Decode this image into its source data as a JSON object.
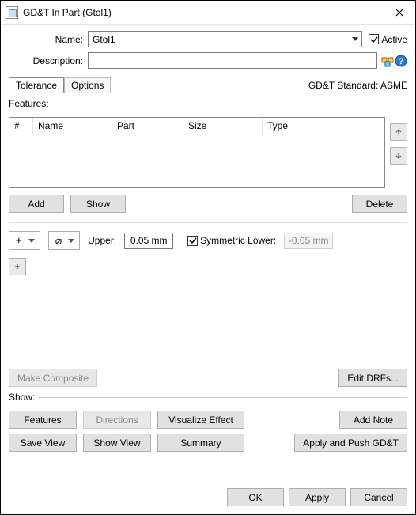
{
  "window": {
    "title": "GD&T In Part (Gtol1)"
  },
  "form": {
    "name_label": "Name:",
    "name_value": "Gtol1",
    "active_label": "Active",
    "description_label": "Description:",
    "description_value": ""
  },
  "tabs": {
    "tolerance": "Tolerance",
    "options": "Options"
  },
  "standard_label": "GD&T Standard: ASME",
  "features": {
    "legend": "Features:",
    "columns": {
      "idx": "#",
      "name": "Name",
      "part": "Part",
      "size": "Size",
      "type": "Type"
    },
    "rows": [],
    "add": "Add",
    "show": "Show",
    "delete": "Delete"
  },
  "tol": {
    "upper_label": "Upper:",
    "upper_value": "0.05 mm",
    "symmetric_label": "Symmetric Lower:",
    "lower_value": "-0.05 mm",
    "plus": "+"
  },
  "composite": {
    "make": "Make Composite",
    "edit_drfs": "Edit DRFs..."
  },
  "show": {
    "legend": "Show:",
    "features": "Features",
    "directions": "Directions",
    "visualize": "Visualize Effect",
    "add_note": "Add Note",
    "save_view": "Save View",
    "show_view": "Show View",
    "summary": "Summary",
    "apply_push": "Apply and Push GD&T"
  },
  "footer": {
    "ok": "OK",
    "apply": "Apply",
    "cancel": "Cancel"
  }
}
